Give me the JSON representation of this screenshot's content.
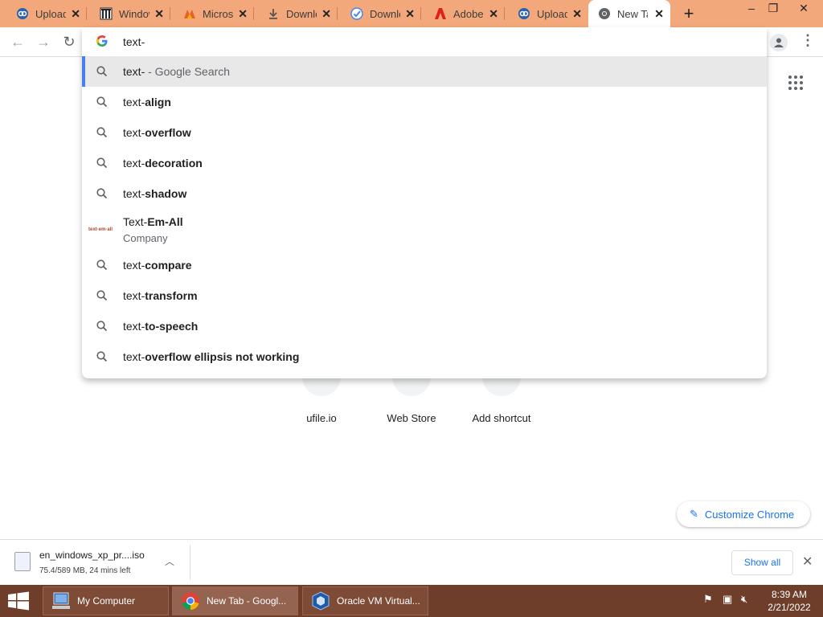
{
  "tabs": [
    {
      "title": "Upload",
      "icon": "cloud-icon",
      "active": false
    },
    {
      "title": "Windows",
      "icon": "columns-icon",
      "active": false
    },
    {
      "title": "Microsoft",
      "icon": "microsoft-icon",
      "active": false
    },
    {
      "title": "Download",
      "icon": "download-icon",
      "active": false
    },
    {
      "title": "Download",
      "icon": "check-circle-icon",
      "active": false
    },
    {
      "title": "Adobe",
      "icon": "adobe-icon",
      "active": false
    },
    {
      "title": "Upload",
      "icon": "cloud-icon",
      "active": false
    },
    {
      "title": "New Tab",
      "icon": "chrome-icon",
      "active": true
    }
  ],
  "omnibox": {
    "typed": "text-"
  },
  "suggestions": [
    {
      "prefix": "text-",
      "bold": "",
      "suffix": " - Google Search",
      "selected": true
    },
    {
      "prefix": "text-",
      "bold": "align",
      "suffix": ""
    },
    {
      "prefix": "text-",
      "bold": "overflow",
      "suffix": ""
    },
    {
      "prefix": "text-",
      "bold": "decoration",
      "suffix": ""
    },
    {
      "prefix": "text-",
      "bold": "shadow",
      "suffix": ""
    },
    {
      "prefix": "Text-",
      "bold": "Em-All",
      "suffix": "",
      "sub": "Company",
      "logo": "text·em·all"
    },
    {
      "prefix": "text-",
      "bold": "compare",
      "suffix": ""
    },
    {
      "prefix": "text-",
      "bold": "transform",
      "suffix": ""
    },
    {
      "prefix": "text-",
      "bold": "to-speech",
      "suffix": ""
    },
    {
      "prefix": "text-",
      "bold": "overflow ellipsis not working",
      "suffix": ""
    }
  ],
  "shortcuts": [
    {
      "label": "ufile.io"
    },
    {
      "label": "Web Store"
    },
    {
      "label": "Add shortcut"
    }
  ],
  "customize_label": "Customize Chrome",
  "download": {
    "filename": "en_windows_xp_pr....iso",
    "status": "75.4/589 MB, 24 mins left",
    "show_all": "Show all"
  },
  "taskbar": {
    "items": [
      {
        "label": "My Computer",
        "active": false
      },
      {
        "label": "New Tab - Googl...",
        "active": true
      },
      {
        "label": "Oracle VM Virtual...",
        "active": false
      }
    ],
    "time": "8:39 AM",
    "date": "2/21/2022"
  }
}
